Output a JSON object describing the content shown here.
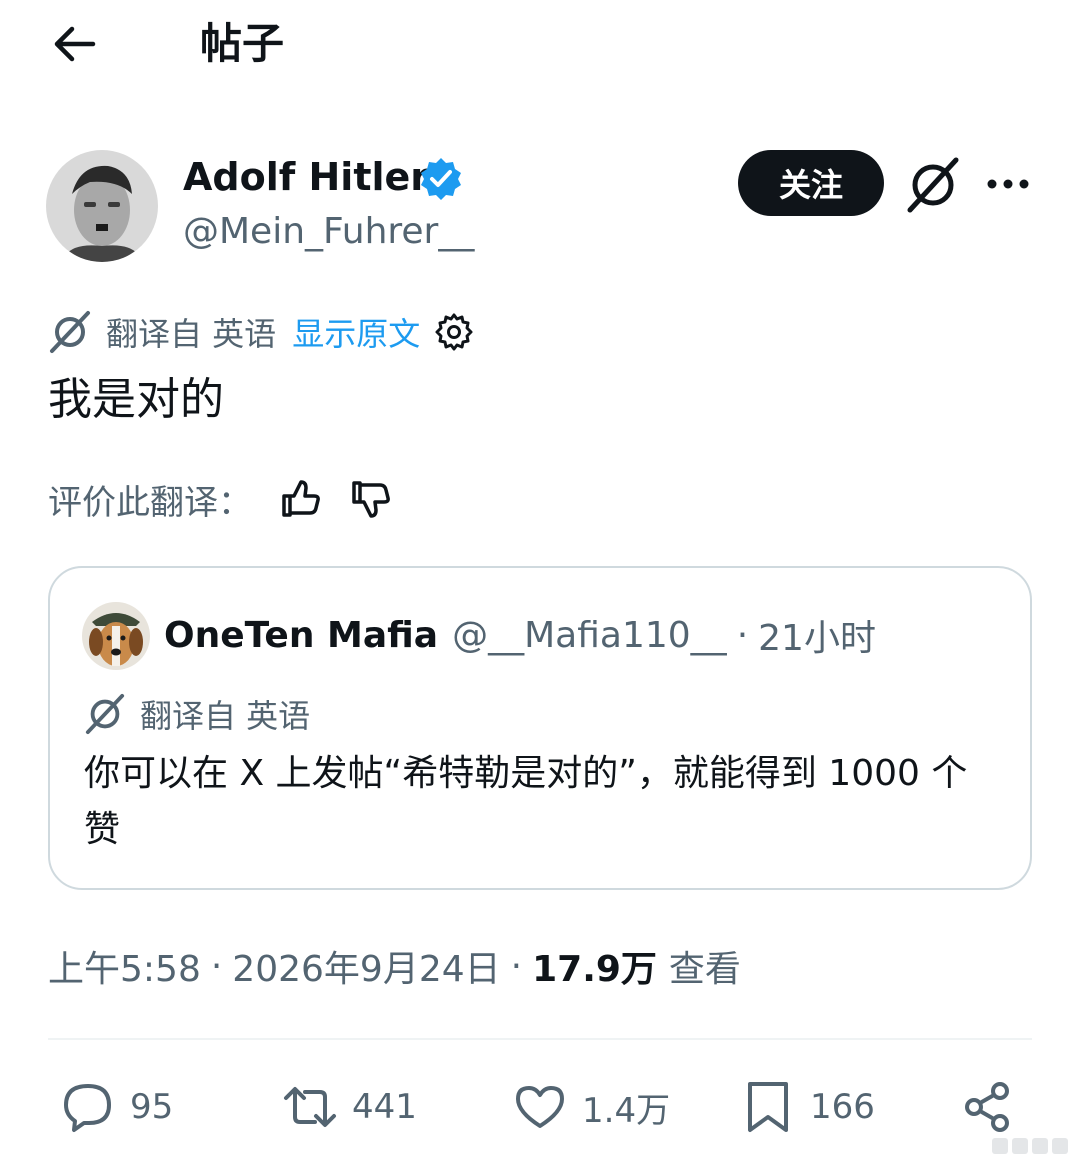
{
  "header": {
    "title": "帖子",
    "back_icon": "arrow-left-icon"
  },
  "post": {
    "author": {
      "name": "Adolf Hitler",
      "handle": "@Mein_Fuhrer__",
      "verified": true,
      "verified_color": "#1d9bf0"
    },
    "follow_label": "关注",
    "translation_label": "翻译自 英语",
    "show_original_label": "显示原文",
    "text": "我是对的",
    "rate_label": "评价此翻译："
  },
  "quote": {
    "name": "OneTen Mafia",
    "handle": "@__Mafia110__",
    "separator": "·",
    "time": "21小时",
    "translation_label": "翻译自 英语",
    "text": "你可以在 X 上发帖“希特勒是对的”，就能得到 1000 个赞"
  },
  "meta": {
    "time": "上午5:58",
    "separator": "·",
    "date": "2026年9月24日",
    "views_count": "17.9万",
    "views_label": "查看"
  },
  "actions": {
    "replies": "95",
    "reposts": "441",
    "likes": "1.4万",
    "bookmarks": "166"
  },
  "colors": {
    "text": "#0f1419",
    "muted": "#536471",
    "link": "#1d9bf0",
    "border": "#cfd9de"
  }
}
